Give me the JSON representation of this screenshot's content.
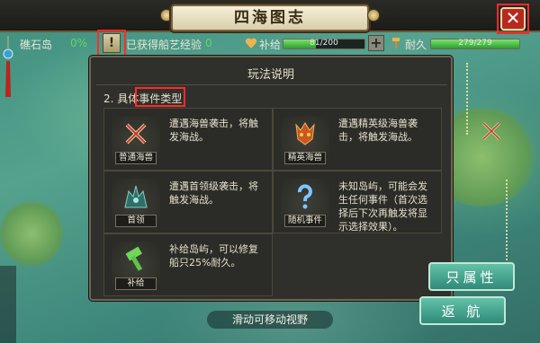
{
  "window": {
    "title": "四海图志",
    "close_label": "✕"
  },
  "status": {
    "location_label": "礁石岛",
    "location_value": "0%",
    "alert_label": "!",
    "exp_label": "已获得船艺经验",
    "exp_value": "0",
    "supply_label": "补给",
    "supply_text": "81/200",
    "supply_current": 81,
    "supply_max": 200,
    "durability_label": "耐久",
    "durability_text": "279/279",
    "durability_current": 279,
    "durability_max": 279,
    "plus_label": "+"
  },
  "panel": {
    "title": "玩法说明",
    "section_number": "2.",
    "section_prefix": "具体",
    "section_highlight": "事件类型",
    "events": [
      {
        "icon": "crossed-swords-icon",
        "label": "普通海兽",
        "desc": "遭遇海兽袭击，将触发海战。"
      },
      {
        "icon": "demon-mask-icon",
        "label": "精英海兽",
        "desc": "遭遇精英级海兽袭击，将触发海战。"
      },
      {
        "icon": "boss-monster-icon",
        "label": "首领",
        "desc": "遭遇首领级袭击，将触发海战。"
      },
      {
        "icon": "question-mark-icon",
        "label": "随机事件",
        "desc": "未知岛屿，可能会发生任何事件（首次选择后下次再触发将显示选择效果）。"
      },
      {
        "icon": "hammer-icon",
        "label": "补给",
        "desc": "补给岛屿，可以修复船只25%耐久。"
      }
    ]
  },
  "footer": {
    "hint": "滑动可移动视野",
    "attr_button": "只属性",
    "return_button": "返 航"
  },
  "colors": {
    "highlight_box": "#ff2a2a",
    "bar_fill": "#4fc04a",
    "panel_bg": "#2f2f2b",
    "map_sea": "#4a9584"
  }
}
